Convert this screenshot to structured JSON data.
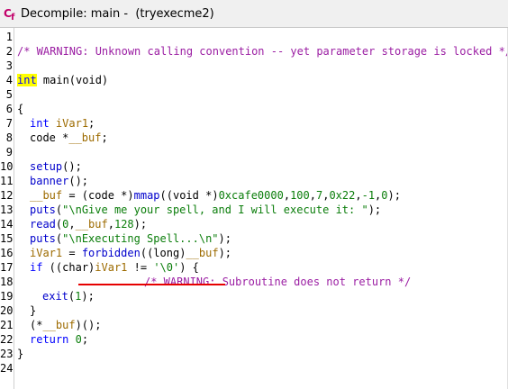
{
  "window": {
    "title": "Decompile: main -  (tryexecme2)",
    "icon": "ghidra-cf-icon",
    "accent": "#c2006a"
  },
  "editor": {
    "line_numbers": [
      "1",
      "2",
      "3",
      "4",
      "5",
      "6",
      "7",
      "8",
      "9",
      "10",
      "11",
      "12",
      "13",
      "14",
      "15",
      "16",
      "17",
      "18",
      "19",
      "20",
      "21",
      "22",
      "23",
      "24"
    ],
    "lines": {
      "l2": "/* WARNING: Unknown calling convention -- yet parameter storage is locked */",
      "l4_kw": "int",
      "l4_rest": " main(void)",
      "l6": "{",
      "l7_kw": "int",
      "l7_var": "iVar1",
      "l7_end": ";",
      "l8_a": "code *",
      "l8_var": "__buf",
      "l8_end": ";",
      "l10_fn": "setup",
      "l10_end": "();",
      "l11_fn": "banner",
      "l11_end": "();",
      "l12_var": "__buf",
      "l12_a": " = (",
      "l12_t": "code",
      "l12_b": " *)",
      "l12_fn": "mmap",
      "l12_c": "((",
      "l12_t2": "void",
      "l12_d": " *)",
      "l12_n1": "0xcafe0000",
      "l12_e": ",",
      "l12_n2": "100",
      "l12_f": ",",
      "l12_n3": "7",
      "l12_g": ",",
      "l12_n4": "0x22",
      "l12_h": ",",
      "l12_n5": "-1",
      "l12_i": ",",
      "l12_n6": "0",
      "l12_j": ");",
      "l13_fn": "puts",
      "l13_a": "(",
      "l13_str": "\"\\nGive me your spell, and I will execute it: \"",
      "l13_b": ");",
      "l14_fn": "read",
      "l14_a": "(",
      "l14_n1": "0",
      "l14_b": ",",
      "l14_var": "__buf",
      "l14_c": ",",
      "l14_n2": "128",
      "l14_d": ");",
      "l15_fn": "puts",
      "l15_a": "(",
      "l15_str": "\"\\nExecuting Spell...\\n\"",
      "l15_b": ");",
      "l16_var": "iVar1",
      "l16_a": " = ",
      "l16_fn": "forbidden",
      "l16_b": "((",
      "l16_t": "long",
      "l16_c": ")",
      "l16_var2": "__buf",
      "l16_d": ");",
      "l17_kw": "if",
      "l17_a": " ((",
      "l17_t": "char",
      "l17_b": ")",
      "l17_var": "iVar1",
      "l17_c": " != ",
      "l17_str": "'\\0'",
      "l17_d": ") {",
      "l18": "/* WARNING: Subroutine does not return */",
      "l19_fn": "exit",
      "l19_a": "(",
      "l19_n": "1",
      "l19_b": ");",
      "l20": "}",
      "l21_a": "(*",
      "l21_var": "__buf",
      "l21_b": ")();",
      "l22_kw": "return",
      "l22_a": " ",
      "l22_n": "0",
      "l22_b": ";",
      "l23": "}"
    }
  }
}
